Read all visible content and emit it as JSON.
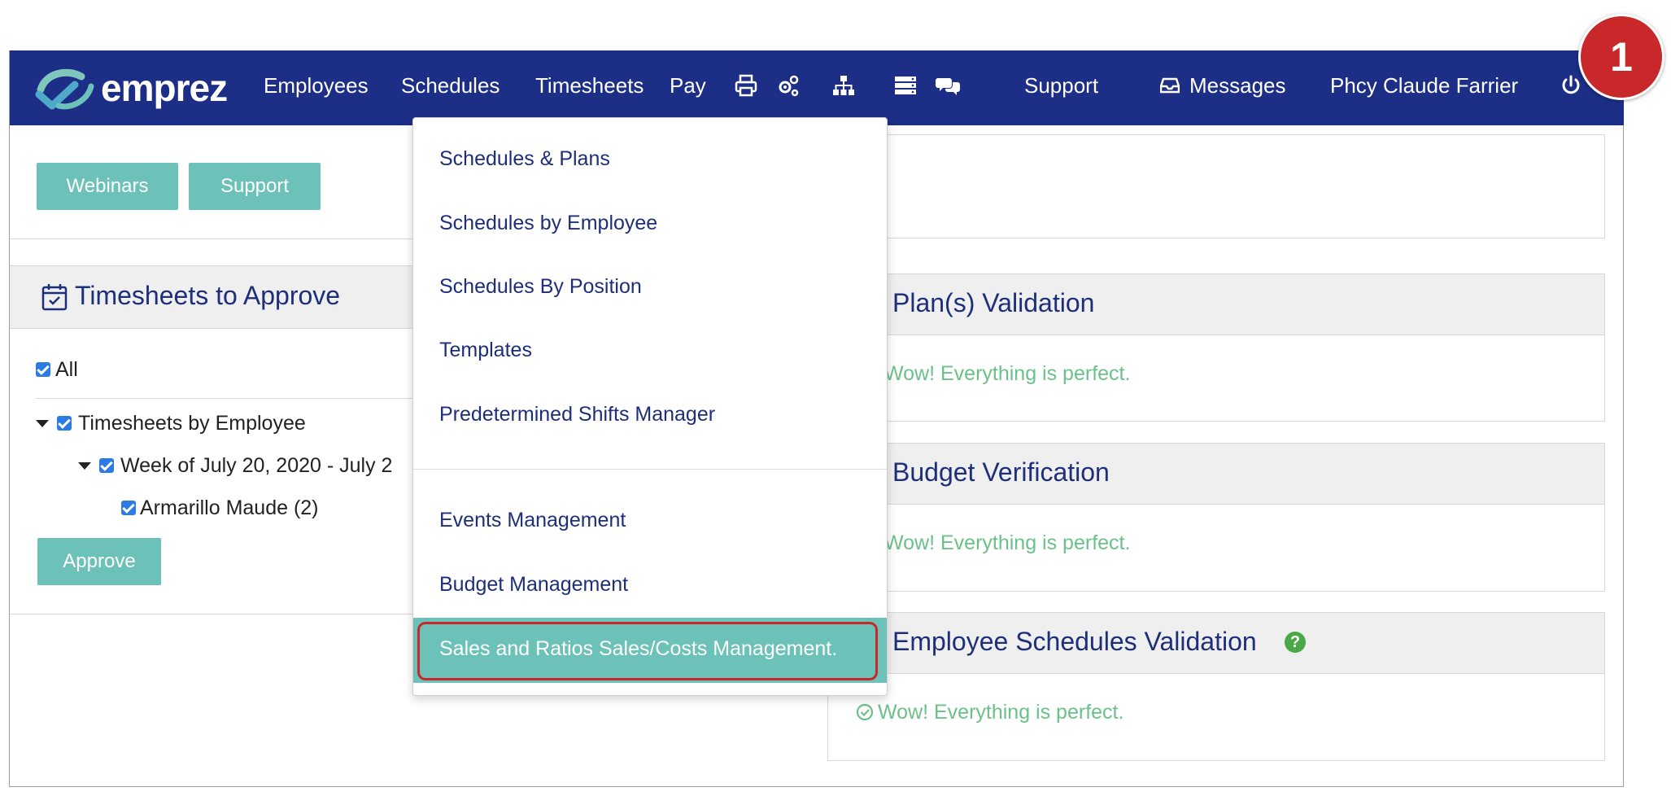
{
  "brand": {
    "name": "emprez"
  },
  "nav": {
    "employees": "Employees",
    "schedules": "Schedules",
    "timesheets": "Timesheets",
    "pay": "Pay",
    "icons": [
      "printer-icon",
      "gears-icon",
      "org-chart-icon",
      "server-list-icon",
      "chat-bubbles-icon"
    ],
    "support": "Support",
    "messages": "Messages",
    "user": "Phcy Claude Farrier"
  },
  "step_badge": "1",
  "buttons": {
    "webinars": "Webinars",
    "support": "Support",
    "approve": "Approve"
  },
  "timesheets_card": {
    "title": "Timesheets to Approve",
    "all": "All",
    "tree": {
      "group": "Timesheets by Employee",
      "week": "Week of July 20, 2020 - July 2",
      "employee": "Armarillo Maude (2)"
    }
  },
  "validations": [
    {
      "title": "Plan(s) Validation",
      "message": "Wow! Everything is perfect."
    },
    {
      "title": "Budget Verification",
      "message": "Wow! Everything is perfect."
    },
    {
      "title": "Employee Schedules Validation",
      "message": "Wow! Everything is perfect."
    }
  ],
  "schedules_menu": {
    "items": [
      "Schedules & Plans",
      "Schedules by Employee",
      "Schedules By Position",
      "Templates",
      "Predetermined Shifts Manager",
      "Events Management",
      "Budget Management",
      "Sales and Ratios Sales/Costs Management."
    ],
    "active_index": 7
  },
  "colors": {
    "navbar": "#1c2e86",
    "teal": "#6cc1b8",
    "success_text": "#6cc08a",
    "highlight": "#c9282a",
    "title_text": "#1e2f7a"
  }
}
